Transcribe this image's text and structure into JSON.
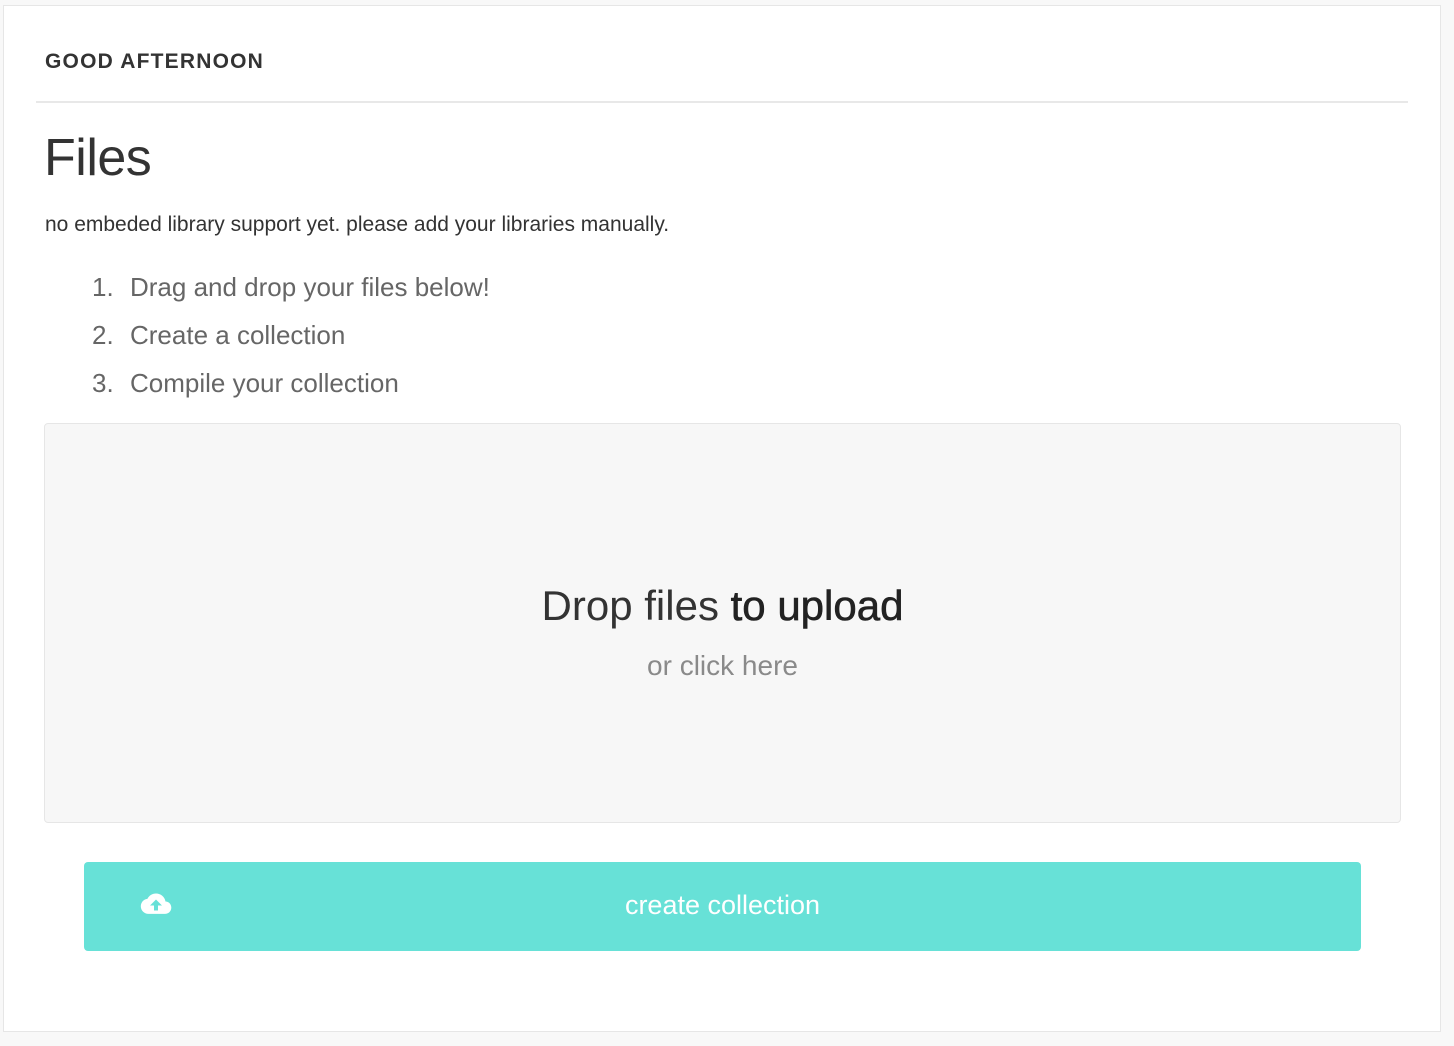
{
  "header": {
    "greeting": "GOOD AFTERNOON"
  },
  "main": {
    "title": "Files",
    "notice": "no embeded library support yet. please add your libraries manually.",
    "steps": [
      {
        "number": "1.",
        "text": "Drag and drop your files below!"
      },
      {
        "number": "2.",
        "text": "Create a collection"
      },
      {
        "number": "3.",
        "text": "Compile your collection"
      }
    ],
    "dropzone": {
      "main_text_light": "Drop files",
      "main_text_strong": "to upload",
      "sub_text": "or click here"
    },
    "create_button": {
      "label": "create collection",
      "icon": "cloud-upload-icon"
    }
  },
  "colors": {
    "accent": "#67e1d7",
    "text": "#333333",
    "muted": "#8a8a8a",
    "dropzone_bg": "#f7f7f7"
  }
}
